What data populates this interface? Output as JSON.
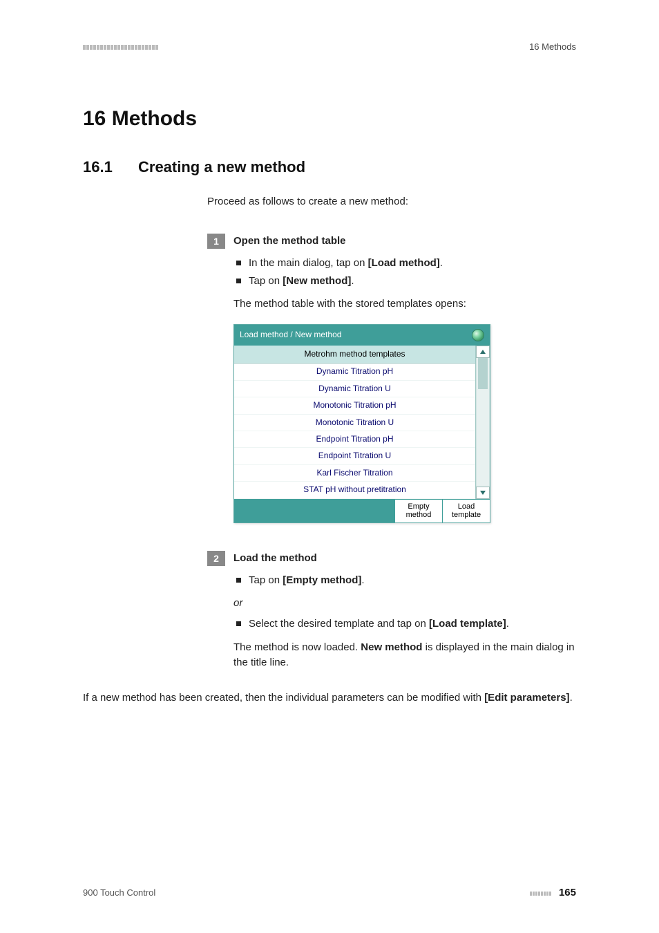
{
  "header": {
    "right": "16 Methods"
  },
  "chapter": "16 Methods",
  "section": {
    "num": "16.1",
    "title": "Creating a new method"
  },
  "intro": "Proceed as follows to create a new method:",
  "step1": {
    "num": "1",
    "title": "Open the method table",
    "b1_pre": "In the main dialog, tap on ",
    "b1_bold": "[Load method]",
    "b1_post": ".",
    "b2_pre": "Tap on ",
    "b2_bold": "[New method]",
    "b2_post": ".",
    "result": "The method table with the stored templates opens:"
  },
  "ui": {
    "title": "Load method / New method",
    "header": "Metrohm method templates",
    "rows": [
      "Dynamic Titration pH",
      "Dynamic Titration U",
      "Monotonic Titration pH",
      "Monotonic Titration U",
      "Endpoint Titration pH",
      "Endpoint Titration U",
      "Karl Fischer Titration",
      "STAT pH without pretitration"
    ],
    "btn1_l1": "Empty",
    "btn1_l2": "method",
    "btn2_l1": "Load",
    "btn2_l2": "template"
  },
  "step2": {
    "num": "2",
    "title": "Load the method",
    "b1_pre": "Tap on ",
    "b1_bold": "[Empty method]",
    "b1_post": ".",
    "or": "or",
    "b2_pre": "Select the desired template and tap on ",
    "b2_bold": "[Load template]",
    "b2_post": ".",
    "result_pre": "The method is now loaded. ",
    "result_bold": "New method",
    "result_post": " is displayed in the main dialog in the title line."
  },
  "closing_pre": "If a new method has been created, then the individual parameters can be modified with ",
  "closing_bold": "[Edit parameters]",
  "closing_post": ".",
  "footer": {
    "left": "900 Touch Control",
    "page": "165"
  }
}
